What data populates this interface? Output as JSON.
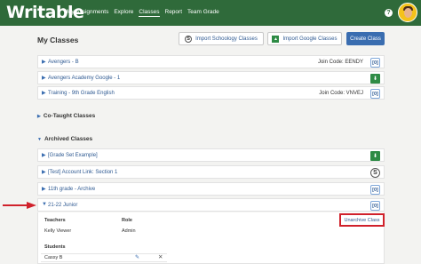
{
  "nav": {
    "logo": "Writable",
    "links": [
      "My Assignments",
      "Explore",
      "Classes",
      "Report",
      "Team Grade"
    ],
    "active": "Classes",
    "help_icon": "?"
  },
  "page": {
    "title": "My Classes",
    "btn_schoology": "Import Schoology Classes",
    "btn_google": "Import Google Classes",
    "btn_create": "Create Class"
  },
  "classes": [
    {
      "name": "Avengers - B",
      "join": "Join Code: EENDY",
      "icon": "classlink-icon"
    },
    {
      "name": "Avengers Academy Google - 1",
      "join": "",
      "icon": "google-classroom-icon"
    },
    {
      "name": "Training - 9th Grade English",
      "join": "Join Code: VNVEJ",
      "icon": "classlink-icon"
    }
  ],
  "sections": {
    "cotaught": "Co-Taught Classes",
    "archived": "Archived Classes"
  },
  "archived": [
    {
      "name": "[Grade Set Example]",
      "icon": "google-classroom-icon"
    },
    {
      "name": "[Test] Account Link: Section 1",
      "icon": "schoology-icon"
    },
    {
      "name": "11th grade - Archive",
      "icon": "classlink-icon"
    },
    {
      "name": "21-22 Junior",
      "icon": "classlink-icon"
    }
  ],
  "expanded": {
    "teachers_header": "Teachers",
    "role_header": "Role",
    "teacher_name": "Kelly Viewer",
    "teacher_role": "Admin",
    "students_header": "Students",
    "student_name": "Cassy B",
    "unarchive": "Unarchive Class"
  },
  "colors": {
    "nav": "#2f6a3a",
    "primary": "#3a6db0",
    "highlight": "#d0212b"
  }
}
